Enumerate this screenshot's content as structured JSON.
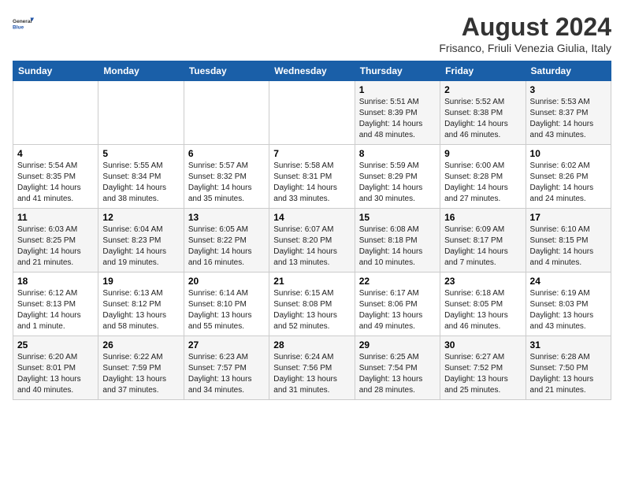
{
  "logo": {
    "line1": "General",
    "line2": "Blue"
  },
  "title": "August 2024",
  "location": "Frisanco, Friuli Venezia Giulia, Italy",
  "days_of_week": [
    "Sunday",
    "Monday",
    "Tuesday",
    "Wednesday",
    "Thursday",
    "Friday",
    "Saturday"
  ],
  "weeks": [
    [
      {
        "day": "",
        "info": ""
      },
      {
        "day": "",
        "info": ""
      },
      {
        "day": "",
        "info": ""
      },
      {
        "day": "",
        "info": ""
      },
      {
        "day": "1",
        "info": "Sunrise: 5:51 AM\nSunset: 8:39 PM\nDaylight: 14 hours and 48 minutes."
      },
      {
        "day": "2",
        "info": "Sunrise: 5:52 AM\nSunset: 8:38 PM\nDaylight: 14 hours and 46 minutes."
      },
      {
        "day": "3",
        "info": "Sunrise: 5:53 AM\nSunset: 8:37 PM\nDaylight: 14 hours and 43 minutes."
      }
    ],
    [
      {
        "day": "4",
        "info": "Sunrise: 5:54 AM\nSunset: 8:35 PM\nDaylight: 14 hours and 41 minutes."
      },
      {
        "day": "5",
        "info": "Sunrise: 5:55 AM\nSunset: 8:34 PM\nDaylight: 14 hours and 38 minutes."
      },
      {
        "day": "6",
        "info": "Sunrise: 5:57 AM\nSunset: 8:32 PM\nDaylight: 14 hours and 35 minutes."
      },
      {
        "day": "7",
        "info": "Sunrise: 5:58 AM\nSunset: 8:31 PM\nDaylight: 14 hours and 33 minutes."
      },
      {
        "day": "8",
        "info": "Sunrise: 5:59 AM\nSunset: 8:29 PM\nDaylight: 14 hours and 30 minutes."
      },
      {
        "day": "9",
        "info": "Sunrise: 6:00 AM\nSunset: 8:28 PM\nDaylight: 14 hours and 27 minutes."
      },
      {
        "day": "10",
        "info": "Sunrise: 6:02 AM\nSunset: 8:26 PM\nDaylight: 14 hours and 24 minutes."
      }
    ],
    [
      {
        "day": "11",
        "info": "Sunrise: 6:03 AM\nSunset: 8:25 PM\nDaylight: 14 hours and 21 minutes."
      },
      {
        "day": "12",
        "info": "Sunrise: 6:04 AM\nSunset: 8:23 PM\nDaylight: 14 hours and 19 minutes."
      },
      {
        "day": "13",
        "info": "Sunrise: 6:05 AM\nSunset: 8:22 PM\nDaylight: 14 hours and 16 minutes."
      },
      {
        "day": "14",
        "info": "Sunrise: 6:07 AM\nSunset: 8:20 PM\nDaylight: 14 hours and 13 minutes."
      },
      {
        "day": "15",
        "info": "Sunrise: 6:08 AM\nSunset: 8:18 PM\nDaylight: 14 hours and 10 minutes."
      },
      {
        "day": "16",
        "info": "Sunrise: 6:09 AM\nSunset: 8:17 PM\nDaylight: 14 hours and 7 minutes."
      },
      {
        "day": "17",
        "info": "Sunrise: 6:10 AM\nSunset: 8:15 PM\nDaylight: 14 hours and 4 minutes."
      }
    ],
    [
      {
        "day": "18",
        "info": "Sunrise: 6:12 AM\nSunset: 8:13 PM\nDaylight: 14 hours and 1 minute."
      },
      {
        "day": "19",
        "info": "Sunrise: 6:13 AM\nSunset: 8:12 PM\nDaylight: 13 hours and 58 minutes."
      },
      {
        "day": "20",
        "info": "Sunrise: 6:14 AM\nSunset: 8:10 PM\nDaylight: 13 hours and 55 minutes."
      },
      {
        "day": "21",
        "info": "Sunrise: 6:15 AM\nSunset: 8:08 PM\nDaylight: 13 hours and 52 minutes."
      },
      {
        "day": "22",
        "info": "Sunrise: 6:17 AM\nSunset: 8:06 PM\nDaylight: 13 hours and 49 minutes."
      },
      {
        "day": "23",
        "info": "Sunrise: 6:18 AM\nSunset: 8:05 PM\nDaylight: 13 hours and 46 minutes."
      },
      {
        "day": "24",
        "info": "Sunrise: 6:19 AM\nSunset: 8:03 PM\nDaylight: 13 hours and 43 minutes."
      }
    ],
    [
      {
        "day": "25",
        "info": "Sunrise: 6:20 AM\nSunset: 8:01 PM\nDaylight: 13 hours and 40 minutes."
      },
      {
        "day": "26",
        "info": "Sunrise: 6:22 AM\nSunset: 7:59 PM\nDaylight: 13 hours and 37 minutes."
      },
      {
        "day": "27",
        "info": "Sunrise: 6:23 AM\nSunset: 7:57 PM\nDaylight: 13 hours and 34 minutes."
      },
      {
        "day": "28",
        "info": "Sunrise: 6:24 AM\nSunset: 7:56 PM\nDaylight: 13 hours and 31 minutes."
      },
      {
        "day": "29",
        "info": "Sunrise: 6:25 AM\nSunset: 7:54 PM\nDaylight: 13 hours and 28 minutes."
      },
      {
        "day": "30",
        "info": "Sunrise: 6:27 AM\nSunset: 7:52 PM\nDaylight: 13 hours and 25 minutes."
      },
      {
        "day": "31",
        "info": "Sunrise: 6:28 AM\nSunset: 7:50 PM\nDaylight: 13 hours and 21 minutes."
      }
    ]
  ]
}
